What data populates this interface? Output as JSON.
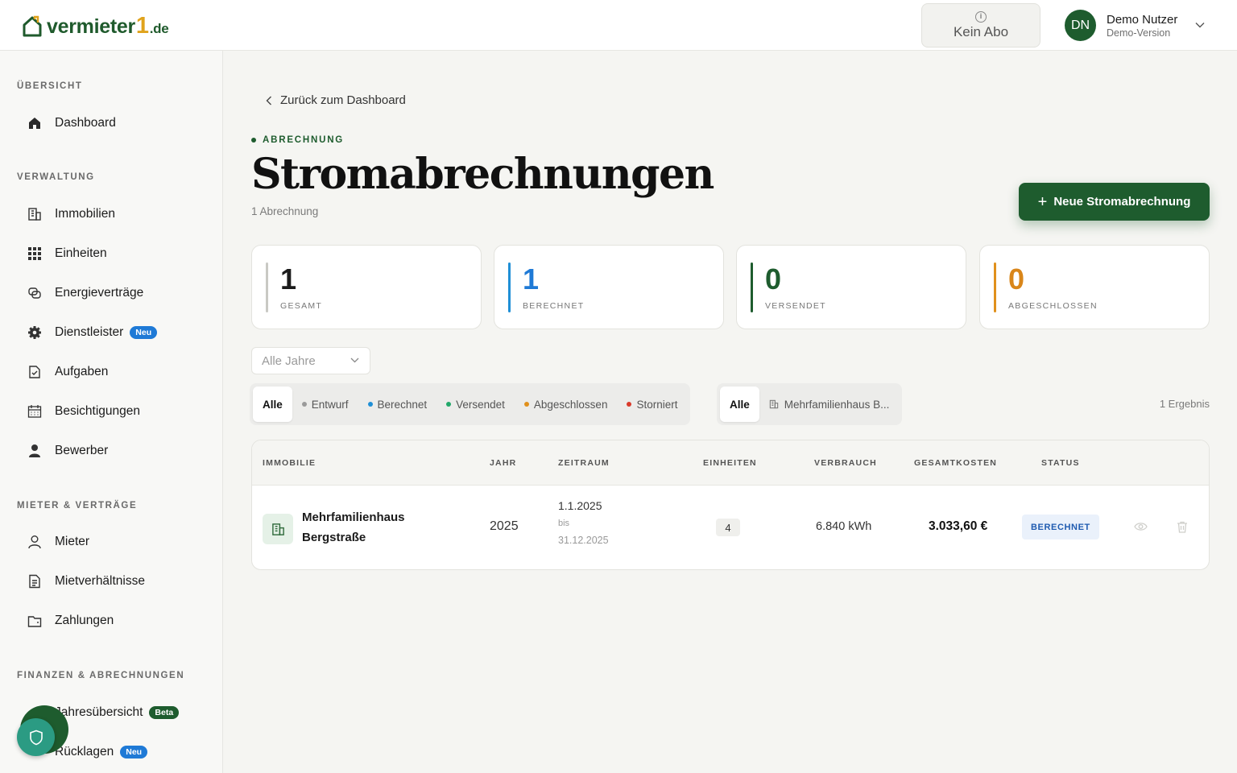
{
  "header": {
    "brand_name": "vermieter",
    "brand_one": "1",
    "brand_tld": ".de",
    "subscription_info": "i",
    "subscription_label": "Kein Abo",
    "user_initials": "DN",
    "user_name": "Demo Nutzer",
    "user_role": "Demo-Version"
  },
  "sidebar": {
    "sections": {
      "overview": "ÜBERSICHT",
      "management": "VERWALTUNG",
      "tenants": "MIETER & VERTRÄGE",
      "finance": "FINANZEN & ABRECHNUNGEN"
    },
    "items": {
      "dashboard": "Dashboard",
      "immobilien": "Immobilien",
      "einheiten": "Einheiten",
      "energievertraege": "Energieverträge",
      "dienstleister": "Dienstleister",
      "dienstleister_badge": "Neu",
      "aufgaben": "Aufgaben",
      "besichtigungen": "Besichtigungen",
      "bewerber": "Bewerber",
      "mieter": "Mieter",
      "mietverhaeltnisse": "Mietverhältnisse",
      "zahlungen": "Zahlungen",
      "jahresuebersicht": "Jahresübersicht",
      "jahresuebersicht_badge": "Beta",
      "ruecklagen": "Rücklagen",
      "ruecklagen_badge": "Neu"
    }
  },
  "main": {
    "back_label": "Zurück zum Dashboard",
    "eyebrow": "ABRECHNUNG",
    "title": "Stromabrechnungen",
    "subtitle": "1 Abrechnung",
    "new_button": "Neue Stromabrechnung",
    "stats": [
      {
        "value": "1",
        "label": "GESAMT",
        "color": "#c9c9c4",
        "value_color": "#1b1b1b"
      },
      {
        "value": "1",
        "label": "BERECHNET",
        "color": "#1f8fd6",
        "value_color": "#1f7ad6"
      },
      {
        "value": "0",
        "label": "VERSENDET",
        "color": "#1e5c2e",
        "value_color": "#1e5c2e"
      },
      {
        "value": "0",
        "label": "ABGESCHLOSSEN",
        "color": "#e0901c",
        "value_color": "#d9861a"
      }
    ],
    "year_filter": "Alle Jahre",
    "status_filters": {
      "all": "Alle",
      "draft": "Entwurf",
      "calculated": "Berechnet",
      "sent": "Versendet",
      "closed": "Abgeschlossen",
      "cancelled": "Storniert"
    },
    "property_filters": {
      "all": "Alle",
      "property": "Mehrfamilienhaus B..."
    },
    "result_count": "1 Ergebnis"
  },
  "table": {
    "headers": {
      "immobilie": "IMMOBILIE",
      "jahr": "JAHR",
      "zeitraum": "ZEITRAUM",
      "einheiten": "EINHEITEN",
      "verbrauch": "VERBRAUCH",
      "gesamtkosten": "GESAMTKOSTEN",
      "status": "STATUS"
    },
    "rows": [
      {
        "immobilie_line1": "Mehrfamilienhaus",
        "immobilie_line2": "Bergstraße",
        "jahr": "2025",
        "zeitraum_von": "1.1.2025",
        "zeitraum_bis_label": "bis",
        "zeitraum_bis": "31.12.2025",
        "einheiten": "4",
        "verbrauch": "6.840 kWh",
        "gesamtkosten": "3.033,60 €",
        "status": "BERECHNET"
      }
    ]
  },
  "colors": {
    "brand_green": "#1e5c2e",
    "brand_accent": "#e0a31c",
    "status_blue": "#1f5bb0"
  }
}
